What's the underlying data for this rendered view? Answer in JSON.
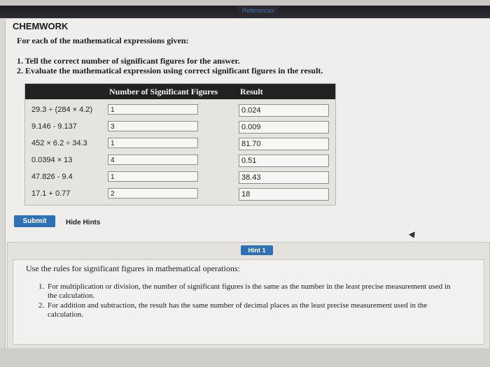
{
  "header": {
    "references_label": "References"
  },
  "section_title": "CHEMWORK",
  "intro": "For each of the mathematical expressions given:",
  "steps": [
    "1. Tell the correct number of significant figures for the answer.",
    "2. Evaluate the mathematical expression using correct significant figures in the result."
  ],
  "table": {
    "col_sig": "Number of Significant Figures",
    "col_result": "Result",
    "rows": [
      {
        "expr": "29.3 ÷ (284 × 4.2)",
        "sig": "1",
        "result": "0.024"
      },
      {
        "expr": "9.146 - 9.137",
        "sig": "3",
        "result": "0.009"
      },
      {
        "expr": "452 × 6.2 ÷ 34.3",
        "sig": "1",
        "result": "81.70"
      },
      {
        "expr": "0.0394 × 13",
        "sig": "4",
        "result": "0.51"
      },
      {
        "expr": "47.826 - 9.4",
        "sig": "1",
        "result": "38.43"
      },
      {
        "expr": "17.1 + 0.77",
        "sig": "2",
        "result": "18"
      }
    ]
  },
  "actions": {
    "submit_label": "Submit",
    "hide_hints_label": "Hide Hints"
  },
  "hint": {
    "tab_label": "Hint 1",
    "intro": "Use the rules for significant figures in mathematical operations:",
    "items": [
      {
        "num": "1.",
        "text": "For multiplication or division, the number of significant figures is the same as the number in the least precise measurement used in the calculation."
      },
      {
        "num": "2.",
        "text": "For addition and subtraction, the result has the same number of decimal places as the least precise measurement used in the calculation."
      }
    ]
  },
  "colors": {
    "accent": "#2f6fb4",
    "header_bg": "#222222"
  }
}
